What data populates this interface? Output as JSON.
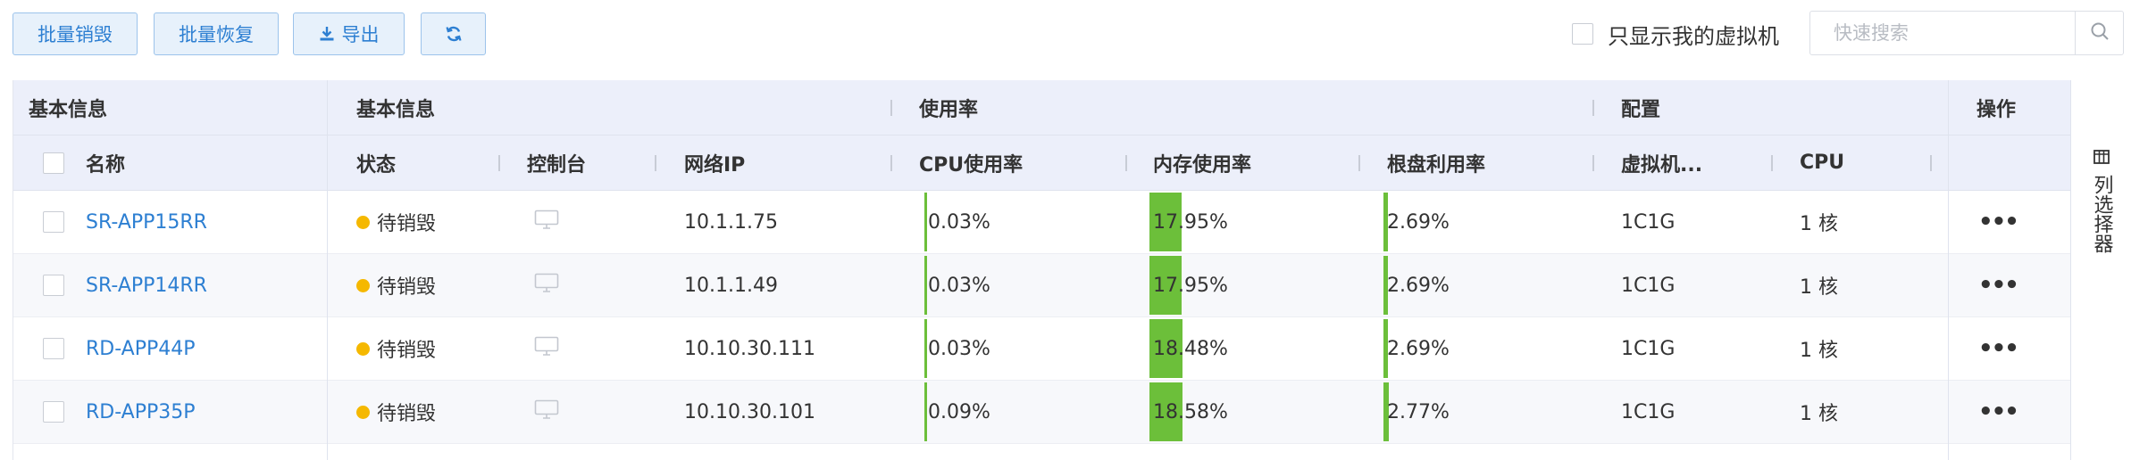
{
  "toolbar": {
    "batch_destroy": "批量销毁",
    "batch_restore": "批量恢复",
    "export": "导出",
    "refresh_icon": "refresh-icon",
    "only_mine_label": "只显示我的虚拟机",
    "search_placeholder": "快速搜索"
  },
  "table": {
    "group_headers": [
      "基本信息",
      "基本信息",
      "使用率",
      "配置",
      "操作"
    ],
    "columns": {
      "name": "名称",
      "status": "状态",
      "console": "控制台",
      "ip": "网络IP",
      "cpu_usage": "CPU使用率",
      "mem_usage": "内存使用率",
      "disk_usage": "根盘利用率",
      "vm_spec": "虚拟机...",
      "cpu": "CPU"
    },
    "rows": [
      {
        "name": "SR-APP15RR",
        "status": "待销毁",
        "ip": "10.1.1.75",
        "cpu_usage": "0.03%",
        "cpu_pct": 0.03,
        "mem_usage": "17.95%",
        "mem_pct": 17.95,
        "disk_usage": "2.69%",
        "disk_pct": 2.69,
        "spec": "1C1G",
        "cpu": "1 核"
      },
      {
        "name": "SR-APP14RR",
        "status": "待销毁",
        "ip": "10.1.1.49",
        "cpu_usage": "0.03%",
        "cpu_pct": 0.03,
        "mem_usage": "17.95%",
        "mem_pct": 17.95,
        "disk_usage": "2.69%",
        "disk_pct": 2.69,
        "spec": "1C1G",
        "cpu": "1 核"
      },
      {
        "name": "RD-APP44P",
        "status": "待销毁",
        "ip": "10.10.30.111",
        "cpu_usage": "0.03%",
        "cpu_pct": 0.03,
        "mem_usage": "18.48%",
        "mem_pct": 18.48,
        "disk_usage": "2.69%",
        "disk_pct": 2.69,
        "spec": "1C1G",
        "cpu": "1 核"
      },
      {
        "name": "RD-APP35P",
        "status": "待销毁",
        "ip": "10.10.30.101",
        "cpu_usage": "0.09%",
        "cpu_pct": 0.09,
        "mem_usage": "18.58%",
        "mem_pct": 18.58,
        "disk_usage": "2.77%",
        "disk_pct": 2.77,
        "spec": "1C1G",
        "cpu": "1 核"
      }
    ]
  },
  "column_chooser": {
    "label": "列选择器",
    "icon": "columns-icon"
  },
  "colors": {
    "accent": "#2d7fd2",
    "status_pending_destroy": "#f5b800",
    "usage_bar": "#6cbf3a",
    "header_bg": "#eceffa"
  }
}
